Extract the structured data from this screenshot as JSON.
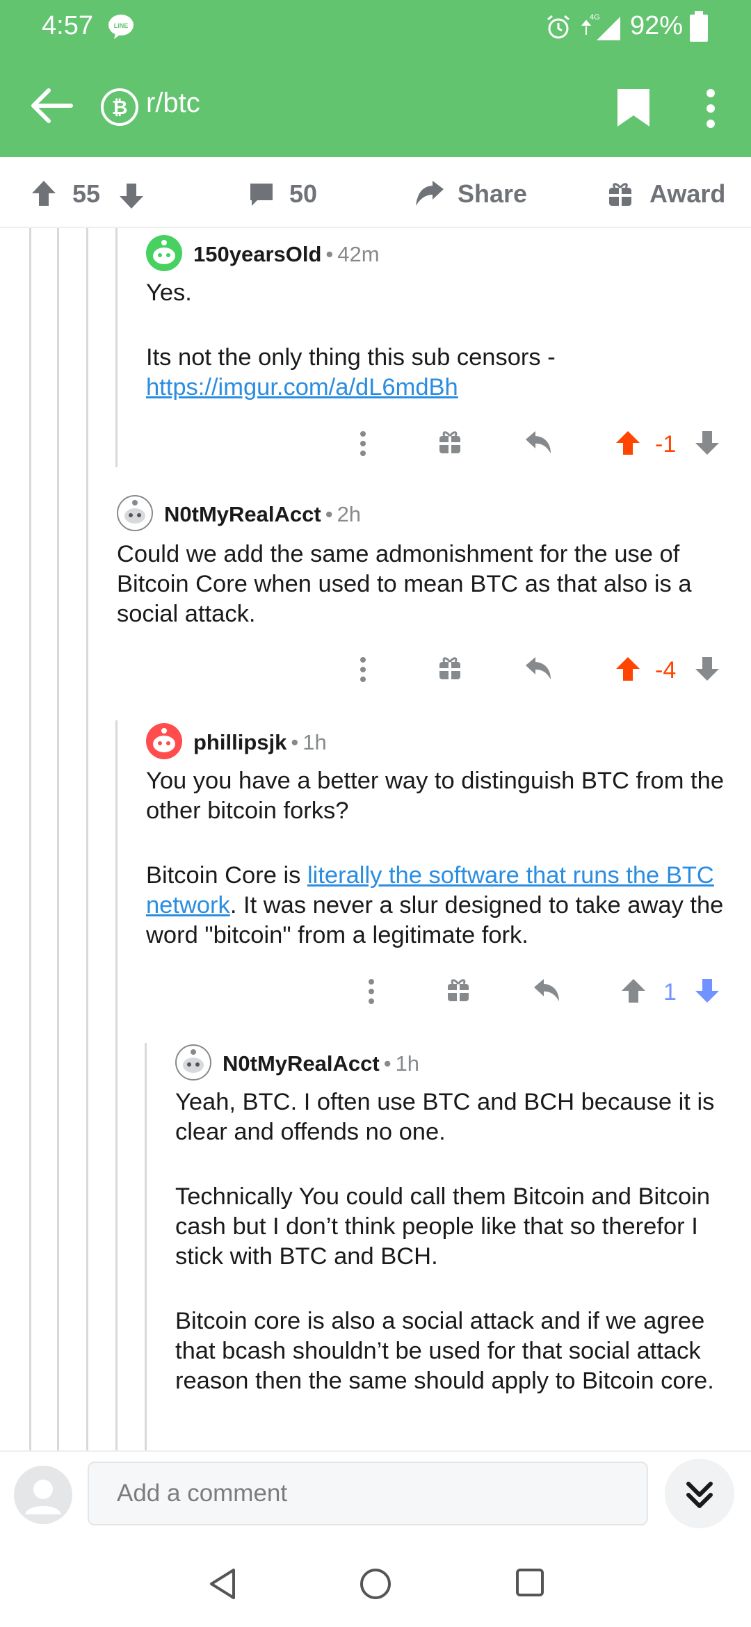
{
  "status_bar": {
    "time": "4:57",
    "line_badge": "LINE",
    "network": "4G",
    "battery": "92%"
  },
  "app_bar": {
    "subreddit": "r/btc"
  },
  "post_actions": {
    "score": "55",
    "comments": "50",
    "share_label": "Share",
    "award_label": "Award"
  },
  "comments": [
    {
      "user": "150yearsOld",
      "time": "42m",
      "lines": [
        "Yes.",
        "Its not the only thing this sub censors -"
      ],
      "link": "https://imgur.com/a/dL6mdBh",
      "score": "-1",
      "vote": "up"
    },
    {
      "user": "N0tMyRealAcct",
      "time": "2h",
      "text": "Could we add the same admonishment for the use of Bitcoin Core when used to mean BTC as that also is a social attack.",
      "score": "-4",
      "vote": "up"
    },
    {
      "user": "phillipsjk",
      "time": "1h",
      "p1": "You you have a better way to distinguish BTC from the other bitcoin forks?",
      "p2_before": "Bitcoin Core is ",
      "p2_link": "literally the software that runs the BTC network",
      "p2_after": ". It was never a slur designed to take away the word \"bitcoin\" from a legitimate fork.",
      "score": "1",
      "vote": "down"
    },
    {
      "user": "N0tMyRealAcct",
      "time": "1h",
      "p1": "Yeah, BTC. I often use BTC and BCH because it is clear and offends no one.",
      "p2": "Technically You could call them Bitcoin and Bitcoin cash but I don’t think people like that so therefor I stick with BTC and BCH.",
      "p3": "Bitcoin core is also a social attack and if we agree that bcash shouldn’t be used for that social attack reason then the same should apply to Bitcoin core."
    }
  ],
  "composer": {
    "placeholder": "Add a comment"
  },
  "colors": {
    "brand_green": "#62c46f",
    "upvote_orange": "#ff4500",
    "downvote_blue": "#7193ff",
    "link_blue": "#2b8de0"
  }
}
